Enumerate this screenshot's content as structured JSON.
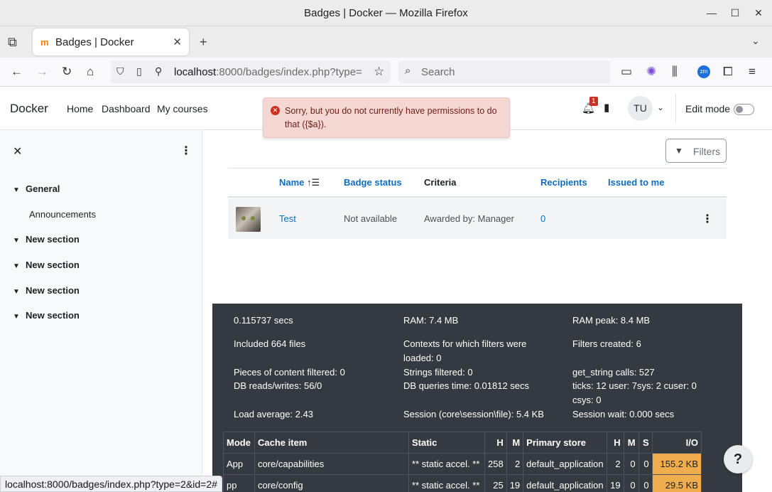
{
  "window": {
    "title": "Badges | Docker — Mozilla Firefox"
  },
  "browser": {
    "tab_title": "Badges | Docker",
    "url_host": "localhost",
    "url_rest": ":8000/badges/index.php?type=",
    "search_placeholder": "Search",
    "status_url": "localhost:8000/badges/index.php?type=2&id=2#"
  },
  "header": {
    "brand": "Docker",
    "nav": [
      "Home",
      "Dashboard",
      "My courses"
    ],
    "notification_count": "1",
    "avatar_initials": "TU",
    "edit_mode_label": "Edit mode"
  },
  "alert": {
    "message": "Sorry, but you do not currently have permissions to do that ({$a})."
  },
  "drawer": {
    "sections": [
      {
        "label": "General",
        "items": [
          "Announcements"
        ]
      },
      {
        "label": "New section"
      },
      {
        "label": "New section"
      },
      {
        "label": "New section"
      },
      {
        "label": "New section"
      }
    ]
  },
  "main": {
    "filters_label": "Filters",
    "columns": [
      "Name",
      "Badge status",
      "Criteria",
      "Recipients",
      "Issued to me"
    ],
    "rows": [
      {
        "name": "Test",
        "status": "Not available",
        "criteria": "Awarded by: Manager",
        "recipients": "0"
      }
    ]
  },
  "perf": {
    "time": "0.115737 secs",
    "ram": "RAM: 7.4 MB",
    "ram_peak": "RAM peak: 8.4 MB",
    "included": "Included 664 files",
    "contexts": "Contexts for which filters were loaded: 0",
    "filters_created": "Filters created: 6",
    "pieces": "Pieces of content filtered: 0",
    "strings": "Strings filtered: 0",
    "get_string": "get_string calls: 527",
    "db_rw": "DB reads/writes: 56/0",
    "db_time": "DB queries time: 0.01812 secs",
    "ticks": "ticks: 12 user: 7sys: 2 cuser: 0 csys: 0",
    "load": "Load average: 2.43",
    "session": "Session (core\\session\\file): 5.4 KB",
    "session_wait": "Session wait: 0.000 secs",
    "cache_headers": [
      "Mode",
      "Cache item",
      "Static",
      "H",
      "M",
      "Primary store",
      "H",
      "M",
      "S",
      "I/O"
    ],
    "cache_rows": [
      [
        "App",
        "core/capabilities",
        "** static accel. **",
        "258",
        "2",
        "default_application",
        "2",
        "0",
        "0",
        "155.2 KB"
      ],
      [
        "pp",
        "core/config",
        "** static accel. **",
        "25",
        "19",
        "default_application",
        "19",
        "0",
        "0",
        "29.5 KB"
      ]
    ]
  },
  "help_label": "?"
}
